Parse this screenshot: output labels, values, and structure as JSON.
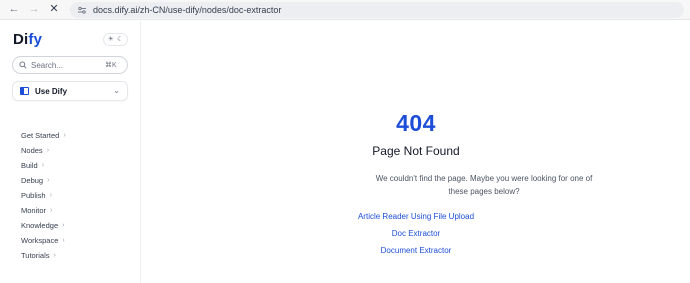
{
  "browser": {
    "url": "docs.dify.ai/zh-CN/use-dify/nodes/doc-extractor"
  },
  "sidebar": {
    "logo_main": "Di",
    "logo_tail": "fy",
    "search_placeholder": "Search...",
    "search_shortcut": "⌘K",
    "version_label": "Use Dify",
    "items": [
      {
        "label": "Get Started"
      },
      {
        "label": "Nodes"
      },
      {
        "label": "Build"
      },
      {
        "label": "Debug"
      },
      {
        "label": "Publish"
      },
      {
        "label": "Monitor"
      },
      {
        "label": "Knowledge"
      },
      {
        "label": "Workspace"
      },
      {
        "label": "Tutorials"
      }
    ]
  },
  "main": {
    "code": "404",
    "title": "Page Not Found",
    "description": "We couldn't find the page. Maybe you were looking for one of these pages below?",
    "suggestions": [
      {
        "label": "Article Reader Using File Upload"
      },
      {
        "label": "Doc Extractor"
      },
      {
        "label": "Document Extractor"
      }
    ]
  },
  "colors": {
    "accent": "#1d4ed8",
    "text": "#111827"
  }
}
